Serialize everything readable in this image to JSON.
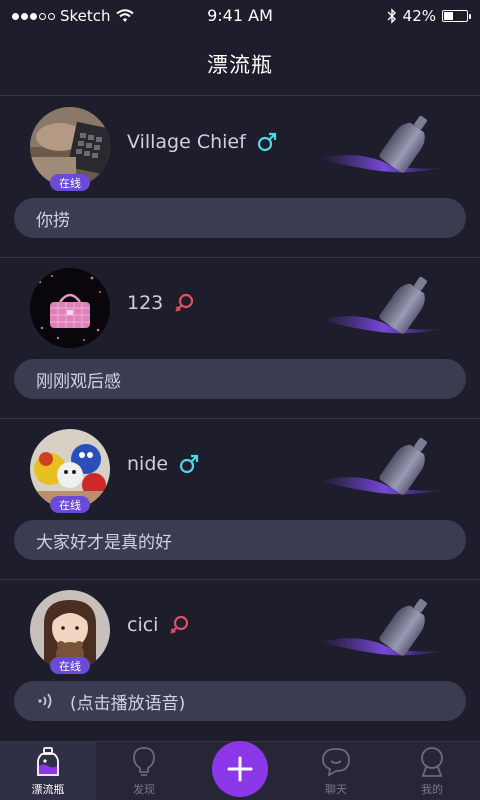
{
  "status_bar": {
    "carrier": "Sketch",
    "time": "9:41 AM",
    "battery": "42%",
    "battery_level": 0.42,
    "signal_bars": 3
  },
  "header": {
    "title": "漂流瓶"
  },
  "online_label": "在线",
  "cards": [
    {
      "name": "Village Chief",
      "gender": "male",
      "online": true,
      "message": "你捞",
      "message_type": "text"
    },
    {
      "name": "123",
      "gender": "female",
      "online": false,
      "message": "刚刚观后感",
      "message_type": "text"
    },
    {
      "name": "nide",
      "gender": "male",
      "online": true,
      "message": "大家好才是真的好",
      "message_type": "text"
    },
    {
      "name": "cici",
      "gender": "female",
      "online": true,
      "message": "(点击播放语音)",
      "message_type": "voice"
    }
  ],
  "tabbar": {
    "tabs": [
      {
        "label": "漂流瓶",
        "icon": "bottle-icon",
        "active": true
      },
      {
        "label": "发现",
        "icon": "lightbulb-icon",
        "active": false
      },
      {
        "label": "",
        "icon": "plus-icon",
        "active": false
      },
      {
        "label": "聊天",
        "icon": "chat-bubble-icon",
        "active": false
      },
      {
        "label": "我的",
        "icon": "profile-icon",
        "active": false
      }
    ]
  },
  "colors": {
    "background": "#1d1d2b",
    "accent": "#8c38e8",
    "online_badge": "#6a4bd8",
    "male": "#4fd6e8",
    "female": "#e0505e"
  }
}
